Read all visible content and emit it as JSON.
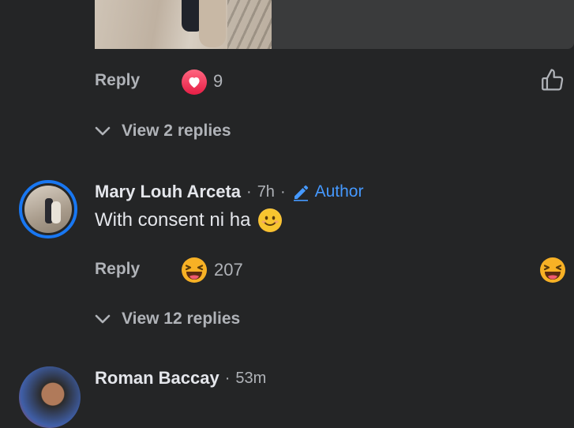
{
  "comment1": {
    "reply_label": "Reply",
    "reaction_icon": "love-reaction-icon",
    "reaction_count": "9",
    "view_replies": "View 2 replies"
  },
  "comment2": {
    "author_name": "Mary Louh Arceta",
    "time": "7h",
    "separator": "·",
    "author_badge": "Author",
    "text": "With consent ni ha",
    "text_emoji": "😊",
    "reply_label": "Reply",
    "reaction_icon": "haha-reaction-icon",
    "reaction_count": "207",
    "view_replies": "View 12 replies"
  },
  "comment3": {
    "author_name": "Roman Baccay",
    "time": "53m",
    "separator": "·"
  },
  "colors": {
    "background": "#242526",
    "text_primary": "#e4e6eb",
    "text_secondary": "#b0b3b8",
    "accent_blue": "#1877f2",
    "author_blue": "#4599ff"
  }
}
